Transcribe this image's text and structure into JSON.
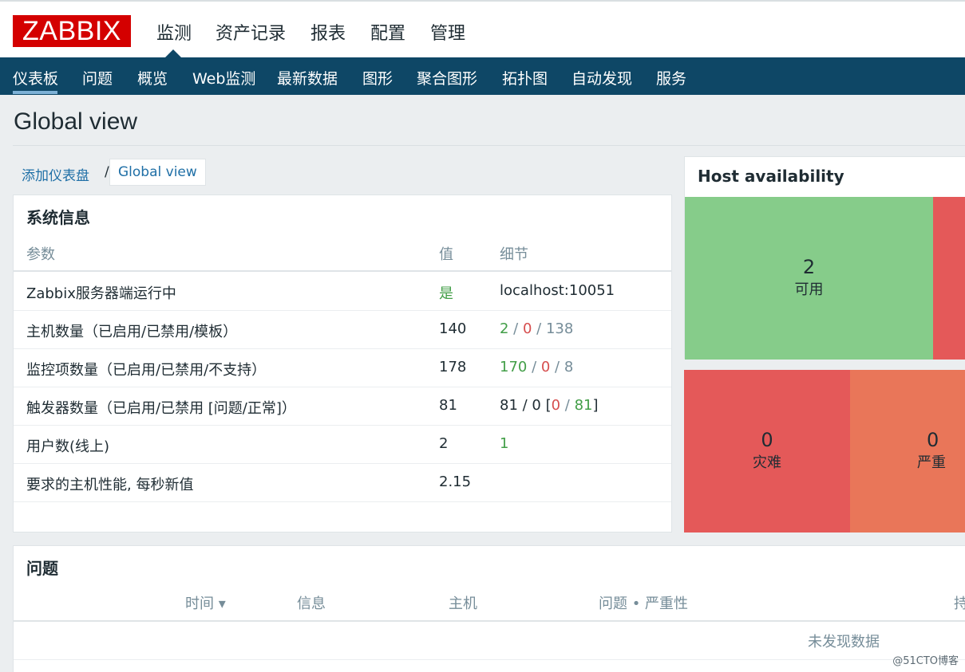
{
  "logo": "ZABBIX",
  "main_menu": [
    {
      "label": "监测",
      "active": true
    },
    {
      "label": "资产记录"
    },
    {
      "label": "报表"
    },
    {
      "label": "配置"
    },
    {
      "label": "管理"
    }
  ],
  "sub_menu": [
    {
      "label": "仪表板",
      "active": true
    },
    {
      "label": "问题"
    },
    {
      "label": "概览"
    },
    {
      "label": "Web监测"
    },
    {
      "label": "最新数据"
    },
    {
      "label": "图形"
    },
    {
      "label": "聚合图形"
    },
    {
      "label": "拓扑图"
    },
    {
      "label": "自动发现"
    },
    {
      "label": "服务"
    }
  ],
  "page_title": "Global view",
  "breadcrumb": {
    "link": "添加仪表盘",
    "separator": "/",
    "current": "Global view"
  },
  "system_info": {
    "title": "系统信息",
    "headers": {
      "param": "参数",
      "value": "值",
      "details": "细节"
    },
    "rows": [
      {
        "param": "Zabbix服务器端运行中",
        "value": "是",
        "details": "localhost:10051"
      },
      {
        "param": "主机数量（已启用/已禁用/模板）",
        "value": "140",
        "d1": "2",
        "d2": "0",
        "d3": "138"
      },
      {
        "param": "监控项数量（已启用/已禁用/不支持）",
        "value": "178",
        "d1": "170",
        "d2": "0",
        "d3": "8"
      },
      {
        "param": "触发器数量（已启用/已禁用 [问题/正常]）",
        "value": "81",
        "d1": "81",
        "d2": "0",
        "d3": "0",
        "d4": "81"
      },
      {
        "param": "用户数(线上)",
        "value": "2",
        "d1": "1"
      },
      {
        "param": "要求的主机性能, 每秒新值",
        "value": "2.15"
      }
    ]
  },
  "host_availability": {
    "title": "Host availability",
    "available": {
      "count": "2",
      "label": "可用"
    }
  },
  "problems_by_severity": [
    {
      "count": "0",
      "label": "灾难"
    },
    {
      "count": "0",
      "label": "严重"
    }
  ],
  "problems": {
    "title": "问题",
    "headers": {
      "time": "时间 ▾",
      "info": "信息",
      "host": "主机",
      "problem": "问题 • 严重性",
      "duration": "持"
    },
    "empty_text": "未发现数据"
  },
  "watermark": "@51CTO博客",
  "colors": {
    "brand": "#d40000",
    "nav": "#0e4766",
    "available": "#86cc8a",
    "disaster": "#e45959",
    "high": "#e97659"
  }
}
